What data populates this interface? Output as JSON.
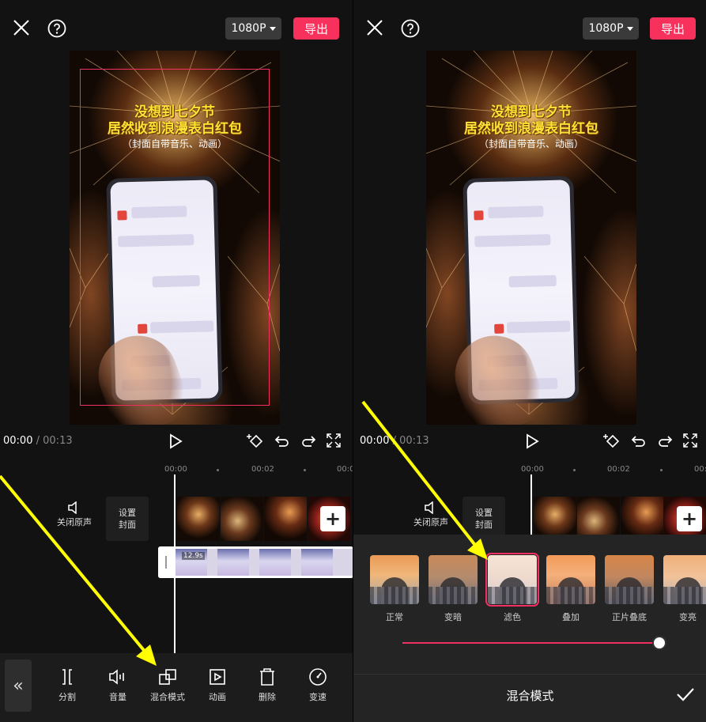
{
  "header": {
    "resolution": "1080P",
    "export_label": "导出"
  },
  "preview": {
    "title_line1": "没想到七夕节",
    "title_line2": "居然收到浪漫表白红包",
    "subtitle": "（封面自带音乐、动画）"
  },
  "playback": {
    "current": "00:00",
    "separator": "/",
    "total": "00:13"
  },
  "timeline": {
    "ruler": [
      "00:00",
      "00:02",
      "00:0"
    ],
    "mute_label": "关闭原声",
    "cover_line1": "设置",
    "cover_line2": "封面",
    "overlay_duration": "12.9s"
  },
  "toolbar": {
    "items": [
      {
        "label": "分割",
        "icon": "split-icon"
      },
      {
        "label": "音量",
        "icon": "volume-icon"
      },
      {
        "label": "混合模式",
        "icon": "blend-icon"
      },
      {
        "label": "动画",
        "icon": "animation-icon"
      },
      {
        "label": "删除",
        "icon": "delete-icon"
      },
      {
        "label": "变速",
        "icon": "speed-icon"
      }
    ]
  },
  "blend_panel": {
    "title": "混合模式",
    "modes": [
      "正常",
      "变暗",
      "滤色",
      "叠加",
      "正片叠底",
      "变亮"
    ],
    "selected": "滤色",
    "slider_value": 1.0
  },
  "colors": {
    "accent": "#f03060",
    "export": "#f8305c",
    "annotation_arrow": "#ffff00"
  }
}
